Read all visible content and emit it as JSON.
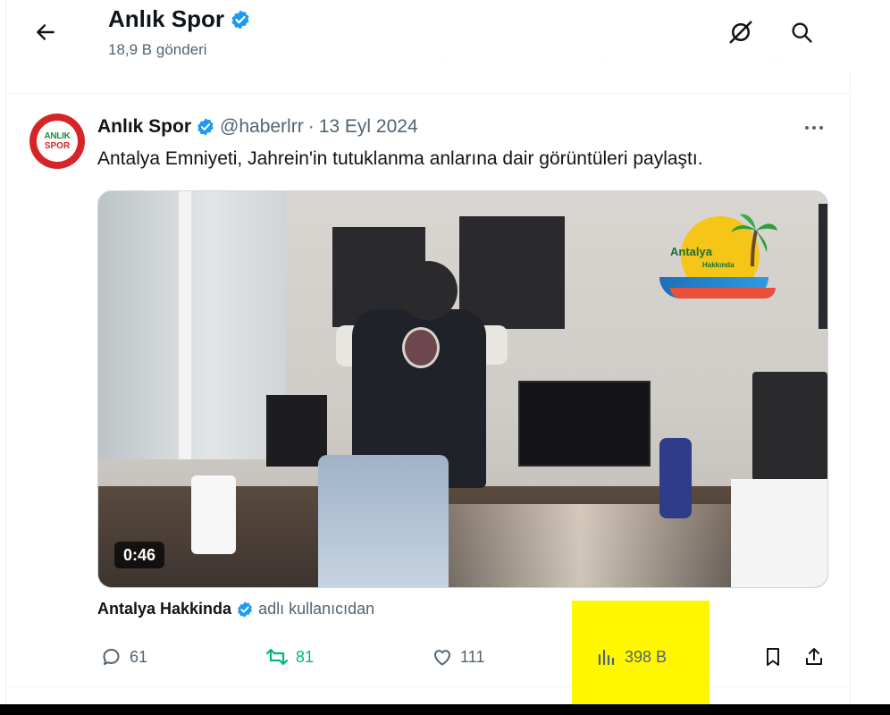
{
  "header": {
    "title": "Anlık Spor",
    "post_count": "18,9 B gönderi"
  },
  "tweet": {
    "author_name": "Anlık Spor",
    "handle": "@haberlrr",
    "separator": "·",
    "date": "13 Eyl 2024",
    "text": "Antalya Emniyeti, Jahrein'in tutuklanma anlarına dair görüntüleri paylaştı.",
    "avatar_text_top": "ANLIK",
    "avatar_text_bottom": "SPOR",
    "video": {
      "duration": "0:46",
      "watermark_title": "Antalya",
      "watermark_subtitle": "Hakkında"
    },
    "source": {
      "name": "Antalya Hakkinda",
      "suffix": "adlı kullanıcıdan"
    },
    "stats": {
      "replies": "61",
      "retweets": "81",
      "likes": "111",
      "views": "398 B"
    }
  },
  "colors": {
    "accent_blue": "#1d9bf0",
    "retweet_green": "#00ba7c",
    "secondary_text": "#536471",
    "highlight_yellow": "#fff700"
  },
  "icons": {
    "back": "arrow-left-icon",
    "verified": "verified-badge-icon",
    "subscribe": "no-notifications-icon",
    "search": "search-icon",
    "more": "more-dots-icon",
    "reply": "reply-icon",
    "retweet": "retweet-icon",
    "like": "heart-icon",
    "views": "bar-chart-icon",
    "bookmark": "bookmark-icon",
    "share": "share-icon"
  }
}
